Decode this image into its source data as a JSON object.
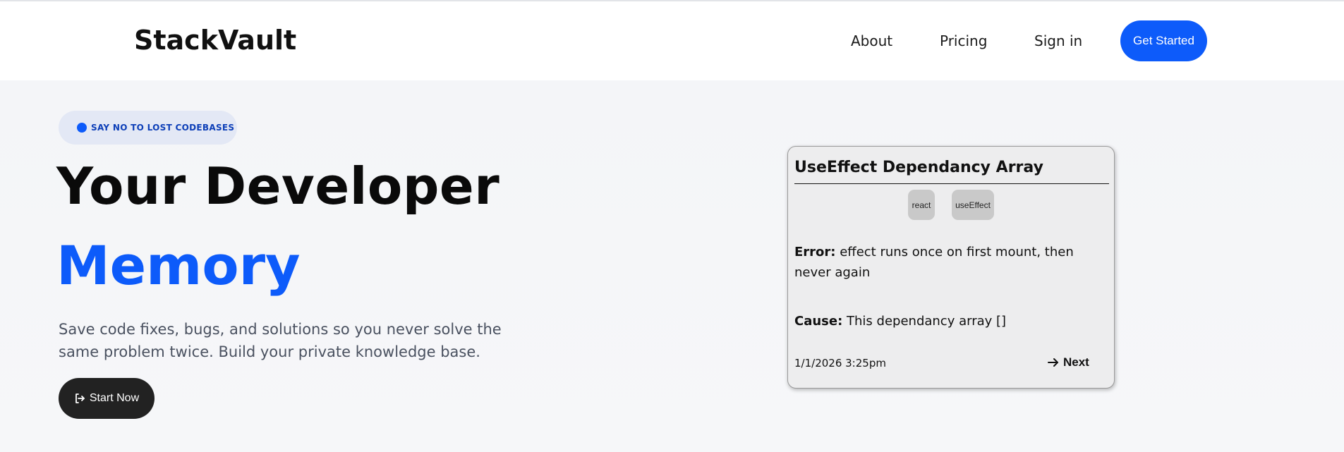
{
  "brand": {
    "name": "StackVault",
    "accent": "#0d5bfa"
  },
  "nav": {
    "links": [
      "About",
      "Pricing",
      "Sign in"
    ],
    "cta_label": "Get Started"
  },
  "hero": {
    "badge": "SAY NO TO LOST CODEBASES",
    "title_line1": "Your Developer",
    "title_line2": "Memory",
    "subtitle": "Save code fixes, bugs, and solutions so you never solve the same problem twice. Build your private knowledge base.",
    "start_label": "Start Now",
    "start_icon": "sign-in-icon"
  },
  "card": {
    "title": "UseEffect Dependancy Array",
    "tags": [
      "react",
      "useEffect"
    ],
    "error_label": "Error:",
    "error_text": "effect runs once on first mount, then never again",
    "cause_label": "Cause:",
    "cause_text": "This dependancy array []",
    "date": "1/1/2026 3:25pm",
    "next_label": "Next",
    "next_icon": "arrow-right-icon"
  }
}
